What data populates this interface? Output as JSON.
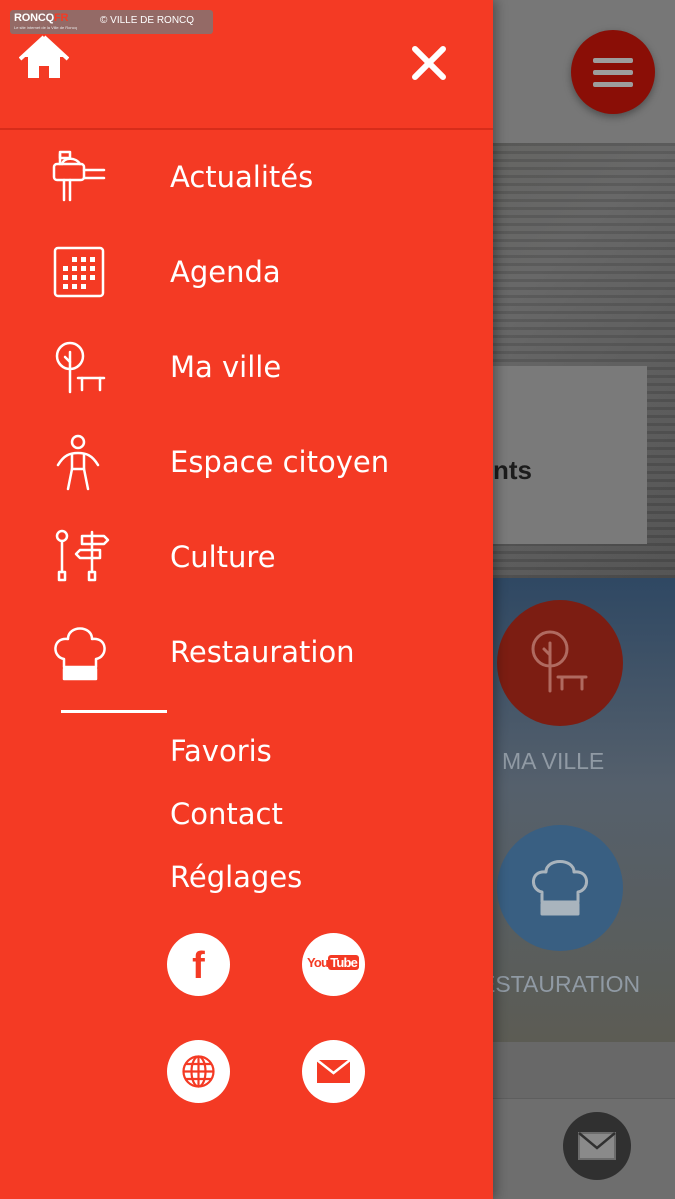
{
  "brand": {
    "logo_main": "RONCQ",
    "logo_suffix": "FR",
    "tagline": "Le site internet de la Ville de Roncq",
    "credit": "© VILLE DE RONCQ"
  },
  "drawer": {
    "home_icon": "home-icon",
    "close_icon": "close-icon",
    "background_color": "#f43a24",
    "nav_items": [
      {
        "label": "Actualités",
        "icon": "mailbox-icon"
      },
      {
        "label": "Agenda",
        "icon": "calendar-icon"
      },
      {
        "label": "Ma ville",
        "icon": "tree-bench-icon"
      },
      {
        "label": "Espace citoyen",
        "icon": "person-icon"
      },
      {
        "label": "Culture",
        "icon": "signpost-icon"
      },
      {
        "label": "Restauration",
        "icon": "chef-hat-icon"
      }
    ],
    "secondary_items": [
      {
        "label": "Favoris"
      },
      {
        "label": "Contact"
      },
      {
        "label": "Réglages"
      }
    ],
    "social": {
      "facebook_glyph": "f",
      "youtube_you": "You",
      "youtube_tube": "Tube",
      "icons": [
        "facebook-icon",
        "youtube-icon",
        "globe-icon",
        "mail-icon"
      ]
    }
  },
  "background": {
    "hero_card_text": "nts",
    "tiles": [
      {
        "label": "MA VILLE",
        "color": "#7c1d12"
      },
      {
        "label": "ESTAURATION",
        "color": "#395f82"
      }
    ],
    "menu_fab_color": "#8a0e06"
  }
}
